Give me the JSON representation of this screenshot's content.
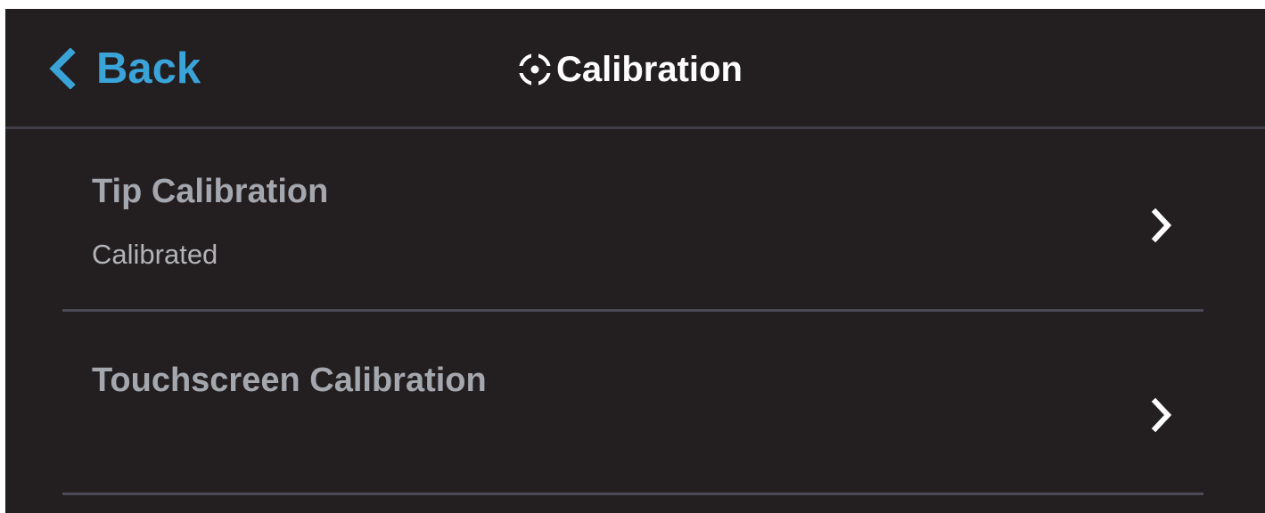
{
  "colors": {
    "background": "#231f20",
    "accent": "#3aa3d8",
    "title": "#ffffff",
    "item_title": "#a4a7ae",
    "item_subtitle": "#b1b3b7",
    "divider": "#4a4a55"
  },
  "header": {
    "back_label": "Back",
    "back_icon": "chevron-left-icon",
    "title": "Calibration",
    "title_icon": "crosshair-target-icon"
  },
  "menu": {
    "items": [
      {
        "title": "Tip Calibration",
        "subtitle": "Calibrated",
        "icon": "chevron-right-icon"
      },
      {
        "title": "Touchscreen Calibration",
        "subtitle": "",
        "icon": "chevron-right-icon"
      }
    ]
  }
}
